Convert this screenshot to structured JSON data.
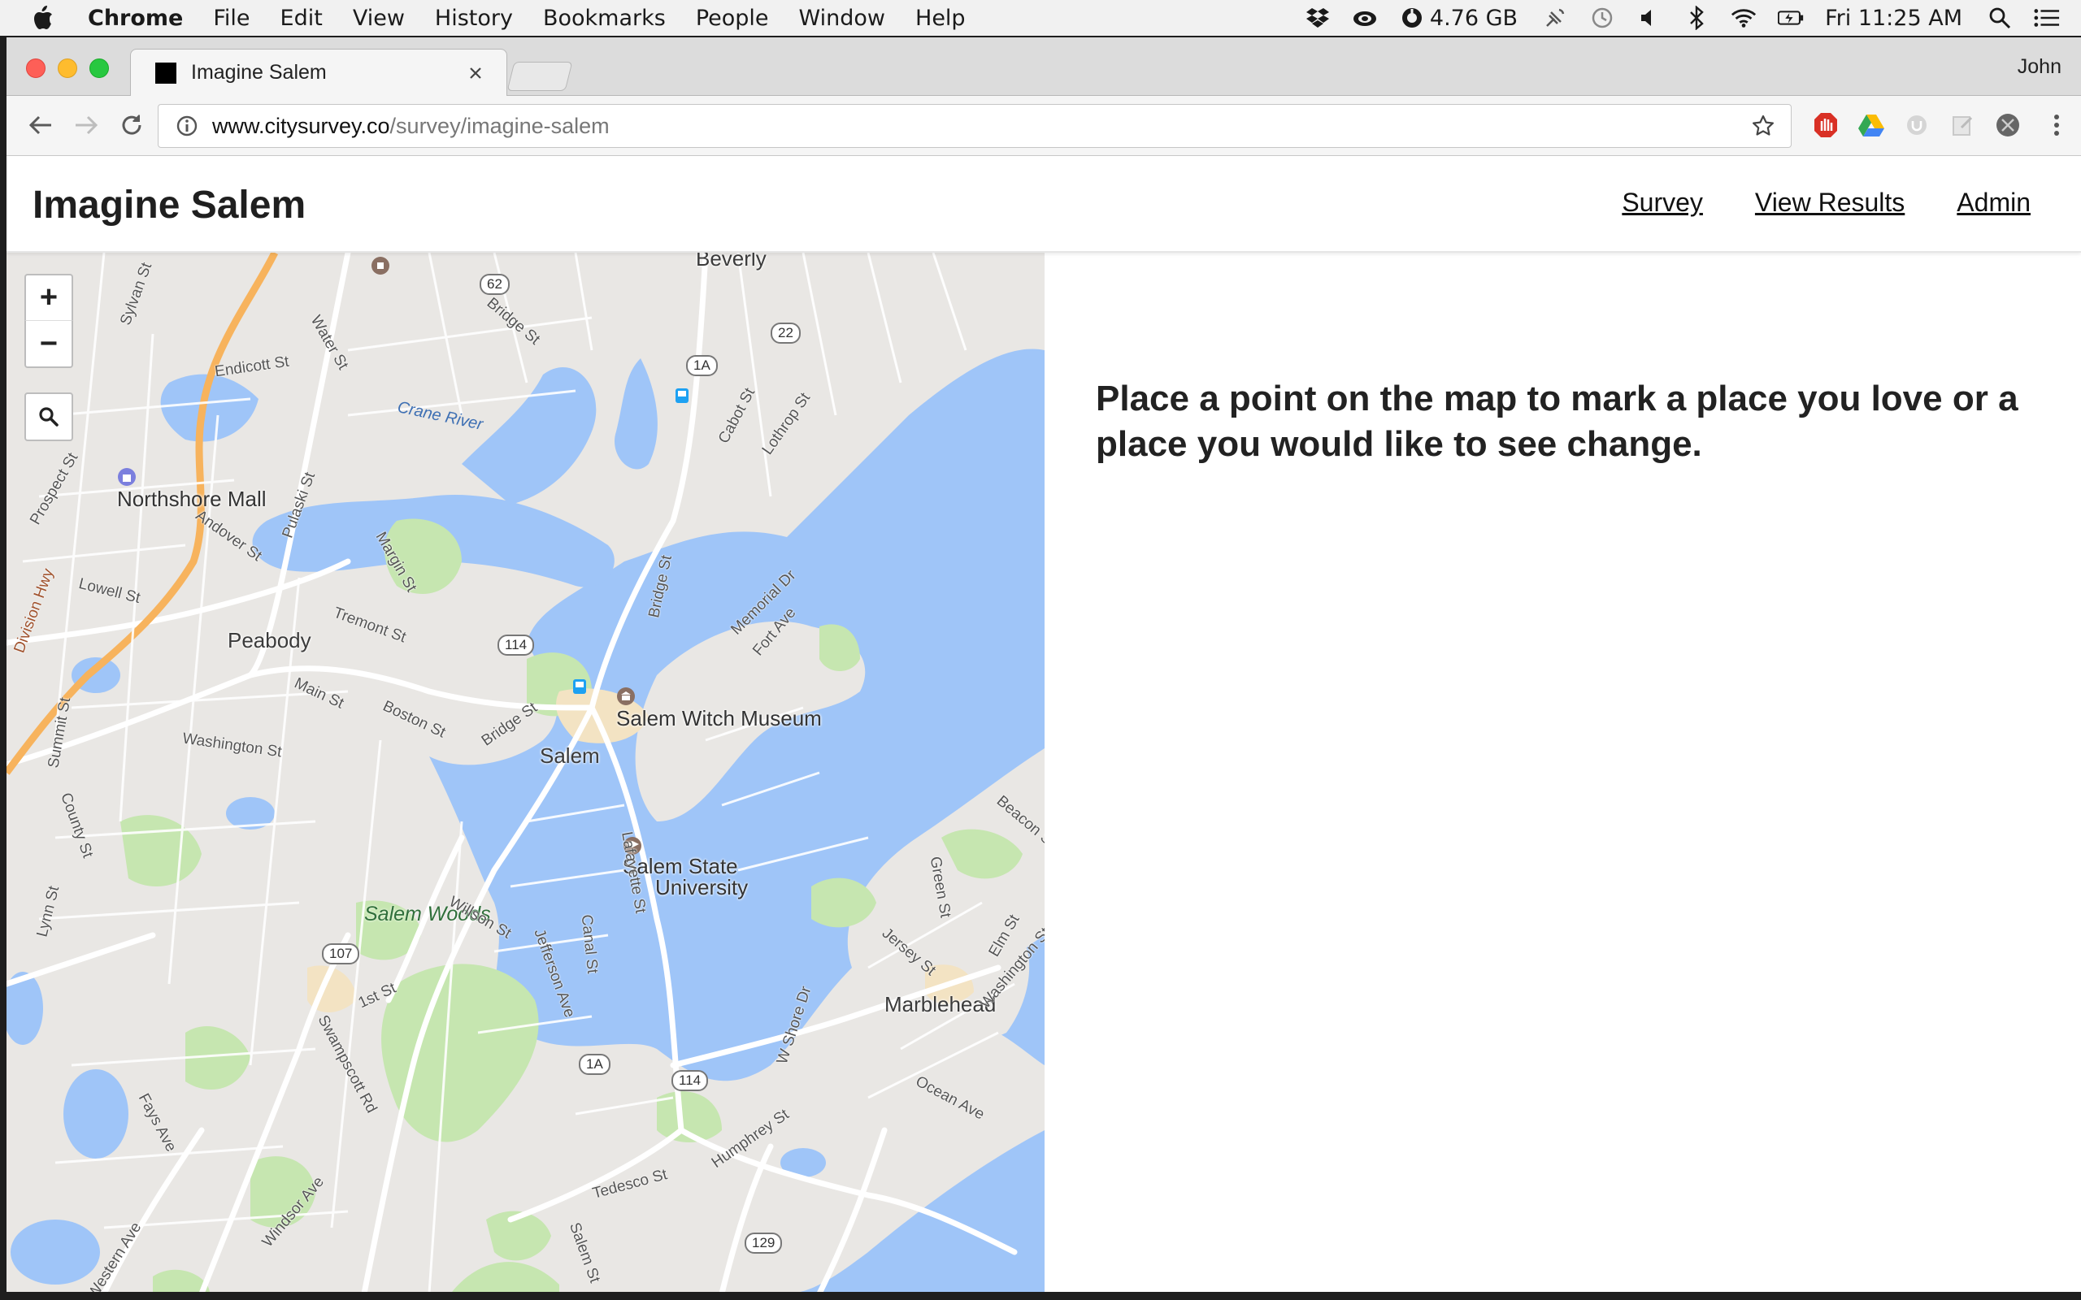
{
  "menubar": {
    "app_name": "Chrome",
    "items": [
      "File",
      "Edit",
      "View",
      "History",
      "Bookmarks",
      "People",
      "Window",
      "Help"
    ],
    "memory": "4.76 GB",
    "clock": "Fri 11:25 AM"
  },
  "browser": {
    "tab_title": "Imagine Salem",
    "profile": "John",
    "url_host": "www.citysurvey.co",
    "url_path": "/survey/imagine-salem"
  },
  "site": {
    "title": "Imagine Salem",
    "nav": [
      "Survey",
      "View Results",
      "Admin"
    ]
  },
  "map": {
    "controls": {
      "zoom_in": "+",
      "zoom_out": "−"
    },
    "places": [
      "Beverly",
      "Peabody",
      "Salem",
      "Marblehead"
    ],
    "pois": [
      "Northshore Mall",
      "Salem Witch Museum",
      "Salem State",
      "University"
    ],
    "parks": [
      "Salem Woods"
    ],
    "water": [
      "Crane River"
    ],
    "routes": [
      "62",
      "22",
      "1A",
      "114",
      "107",
      "1A",
      "114",
      "129"
    ],
    "streets": [
      "Sylvan St",
      "Endicott St",
      "Water St",
      "Bridge St",
      "Cabot St",
      "Lothrop St",
      "Prospect St",
      "Pulaski St",
      "Andover St",
      "Lowell St",
      "Margin St",
      "Bridge St",
      "Memorial Dr",
      "Fort Ave",
      "Tremont St",
      "Division Hwy",
      "Main St",
      "Boston St",
      "Washington St",
      "Summit St",
      "County St",
      "Lafayette St",
      "Willson St",
      "Jefferson Ave",
      "Canal St",
      "Lynn St",
      "1st St",
      "Swampscott Rd",
      "Fays Ave",
      "W Shore Dr",
      "Humphrey St",
      "Tedesco St",
      "Ocean Ave",
      "Green St",
      "Jersey St",
      "Elm St",
      "Washington St",
      "Beacon St",
      "Windsor Ave",
      "Western Ave",
      "Salem St",
      "Bridge St"
    ]
  },
  "instructions": "Place a point on the map to mark a place you love or a place you would like to see change."
}
